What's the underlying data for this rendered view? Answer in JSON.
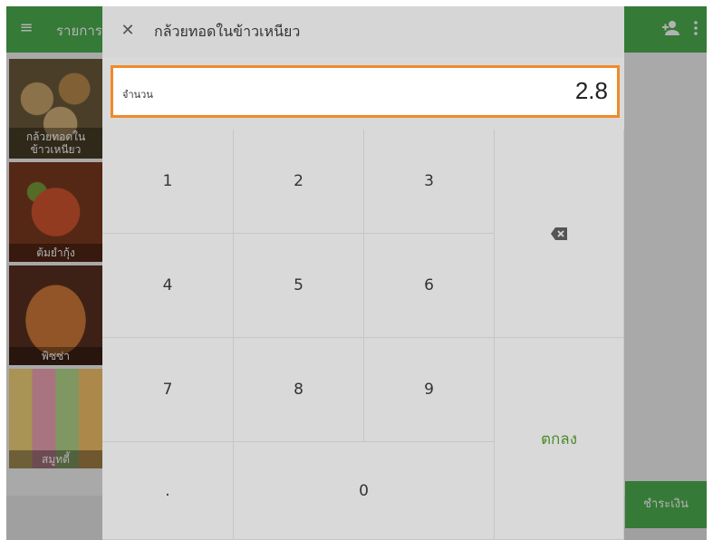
{
  "background_app": {
    "title": "รายการ",
    "tiles": [
      {
        "label": "กล้วยทอดใน\nข้าวเหนียว"
      },
      {
        "label": "ต้มยำกุ้ง"
      },
      {
        "label": "พิซซ่า"
      },
      {
        "label": "สมูทตี้"
      }
    ],
    "bottom_button": "ชำระเงิน"
  },
  "dialog": {
    "title": "กล้วยทอดในข้าวเหนียว",
    "quantity_label": "จำนวน",
    "quantity_value": "2.8",
    "keys": {
      "k1": "1",
      "k2": "2",
      "k3": "3",
      "k4": "4",
      "k5": "5",
      "k6": "6",
      "k7": "7",
      "k8": "8",
      "k9": "9",
      "dot": ".",
      "k0": "0",
      "ok": "ตกลง"
    }
  },
  "colors": {
    "accent_green": "#4caf50",
    "focus_orange": "#f08a2c",
    "ok_text": "#4c8a2a"
  },
  "icons": {
    "menu": "menu-icon",
    "add_user": "add-user-icon",
    "more": "more-vert-icon",
    "close": "close-icon",
    "backspace": "backspace-icon"
  }
}
